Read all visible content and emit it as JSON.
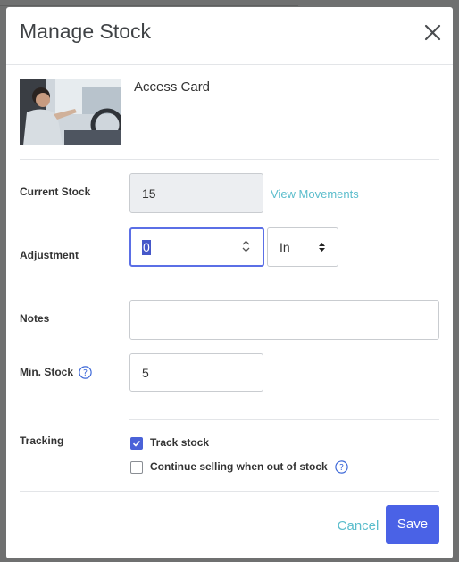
{
  "modal": {
    "title": "Manage Stock",
    "close_icon": "close-icon"
  },
  "product": {
    "name": "Access Card",
    "thumbnail_icon": "product-photo"
  },
  "current_stock": {
    "label": "Current Stock",
    "value": "15",
    "link": "View Movements"
  },
  "adjustment": {
    "label": "Adjustment",
    "value": "0",
    "direction": "In"
  },
  "notes": {
    "label": "Notes",
    "value": ""
  },
  "min_stock": {
    "label": "Min. Stock",
    "value": "5",
    "help_icon": "question-circle-icon"
  },
  "tracking": {
    "label": "Tracking",
    "track_stock": {
      "label": "Track stock",
      "checked": true
    },
    "continue_selling": {
      "label": "Continue selling when out of stock",
      "checked": false,
      "help_icon": "question-circle-icon"
    }
  },
  "footer": {
    "cancel_label": "Cancel",
    "save_label": "Save"
  },
  "colors": {
    "accent": "#4a62e6",
    "link": "#5bbdcc",
    "backdrop": "#6f7070"
  }
}
